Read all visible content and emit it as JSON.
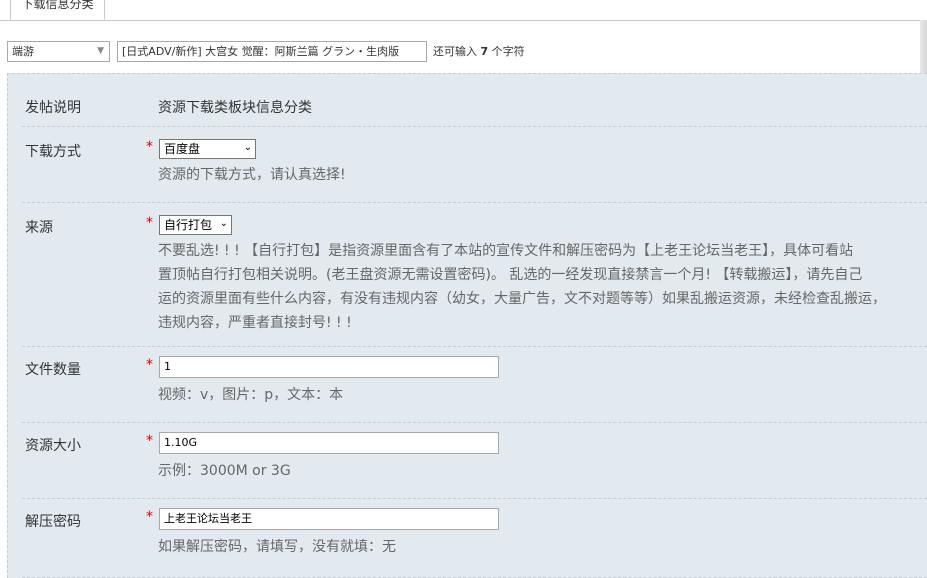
{
  "tab": {
    "label": "下载信息分类"
  },
  "subject": {
    "type_value": "端游",
    "title_value": "[日式ADV/新作] 大宫女 觉醒：阿斯兰篇 グラン・生肉版",
    "hint_prefix": "还可输入",
    "hint_count": "7",
    "hint_suffix": "个字符"
  },
  "form": {
    "post_info": {
      "label": "发帖说明",
      "value": "资源下载类板块信息分类"
    },
    "download_method": {
      "label": "下载方式",
      "required": "*",
      "selected": "百度盘",
      "help": "资源的下载方式，请认真选择!"
    },
    "source": {
      "label": "来源",
      "required": "*",
      "selected": "自行打包",
      "help_lines": [
        "不要乱选! ! ! 【自行打包】是指资源里面含有了本站的宣传文件和解压密码为【上老王论坛当老王】，具体可看站",
        "置顶帖自行打包相关说明。(老王盘资源无需设置密码)。 乱选的一经发现直接禁言一个月! 【转载搬运】，请先自己",
        "运的资源里面有些什么内容，有没有违规内容（幼女，大量广告，文不对题等等）如果乱搬运资源，未经检查乱搬运，",
        "违规内容，严重者直接封号! ! !"
      ]
    },
    "file_count": {
      "label": "文件数量",
      "required": "*",
      "value": "1",
      "help": "视频：v，图片：p，文本：本"
    },
    "resource_size": {
      "label": "资源大小",
      "required": "*",
      "value": "1.10G",
      "help": "示例：3000M or 3G"
    },
    "unzip_password": {
      "label": "解压密码",
      "required": "*",
      "value": "上老王论坛当老王",
      "help": "如果解压密码，请填写，没有就填：无"
    }
  }
}
